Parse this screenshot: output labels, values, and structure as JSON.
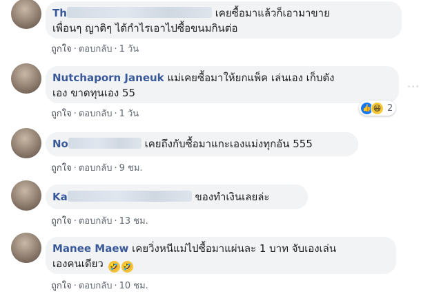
{
  "comments": [
    {
      "name": "Th",
      "text_1": "เคยซื้อมาแล้วก็เอามาขาย",
      "text_2": "เพื่อนๆ ญาติๆ ได้กำไรเอาไปซื้อขนมกินต่อ",
      "like": "ถูกใจ",
      "reply": "ตอบกลับ",
      "time": "1 วัน"
    },
    {
      "name": "Nutchaporn Janeuk",
      "text_1": "แม่เคยซื้อมาให้ยกแพ็ค เล่นเอง เก็บตัง",
      "text_2": "เอง ขาดทุนเอง 55",
      "like": "ถูกใจ",
      "reply": "ตอบกลับ",
      "time": "1 วัน",
      "reaction_count": "2",
      "more_icon": "more-options-icon"
    },
    {
      "name": "No",
      "text_1": "เคยถึงกับซื้อมาแกะเองแม่งทุกอัน 555",
      "like": "ถูกใจ",
      "reply": "ตอบกลับ",
      "time": "9 ชม."
    },
    {
      "name": "Ka",
      "text_1": "ของทำเงินเลยล่ะ",
      "like": "ถูกใจ",
      "reply": "ตอบกลับ",
      "time": "13 ชม."
    },
    {
      "name": "Manee Maew",
      "text_1": "เคยวิ่งหนีแม่ไปซื้อมาแผ่นละ 1 บาท จับเองเล่น",
      "text_2": "เองคนเดียว",
      "like": "ถูกใจ",
      "reply": "ตอบกลับ",
      "time": "10 ชม."
    }
  ],
  "separator": "·",
  "more_glyph": "···",
  "icons": {
    "reaction_like": "thumbs-up-icon",
    "reaction_haha": "laughing-face-icon",
    "emoji": "rolling-laughing-emoji"
  },
  "colors": {
    "name": "#385898",
    "bubble": "#f2f3f5",
    "like_blue": "#1877f2"
  }
}
